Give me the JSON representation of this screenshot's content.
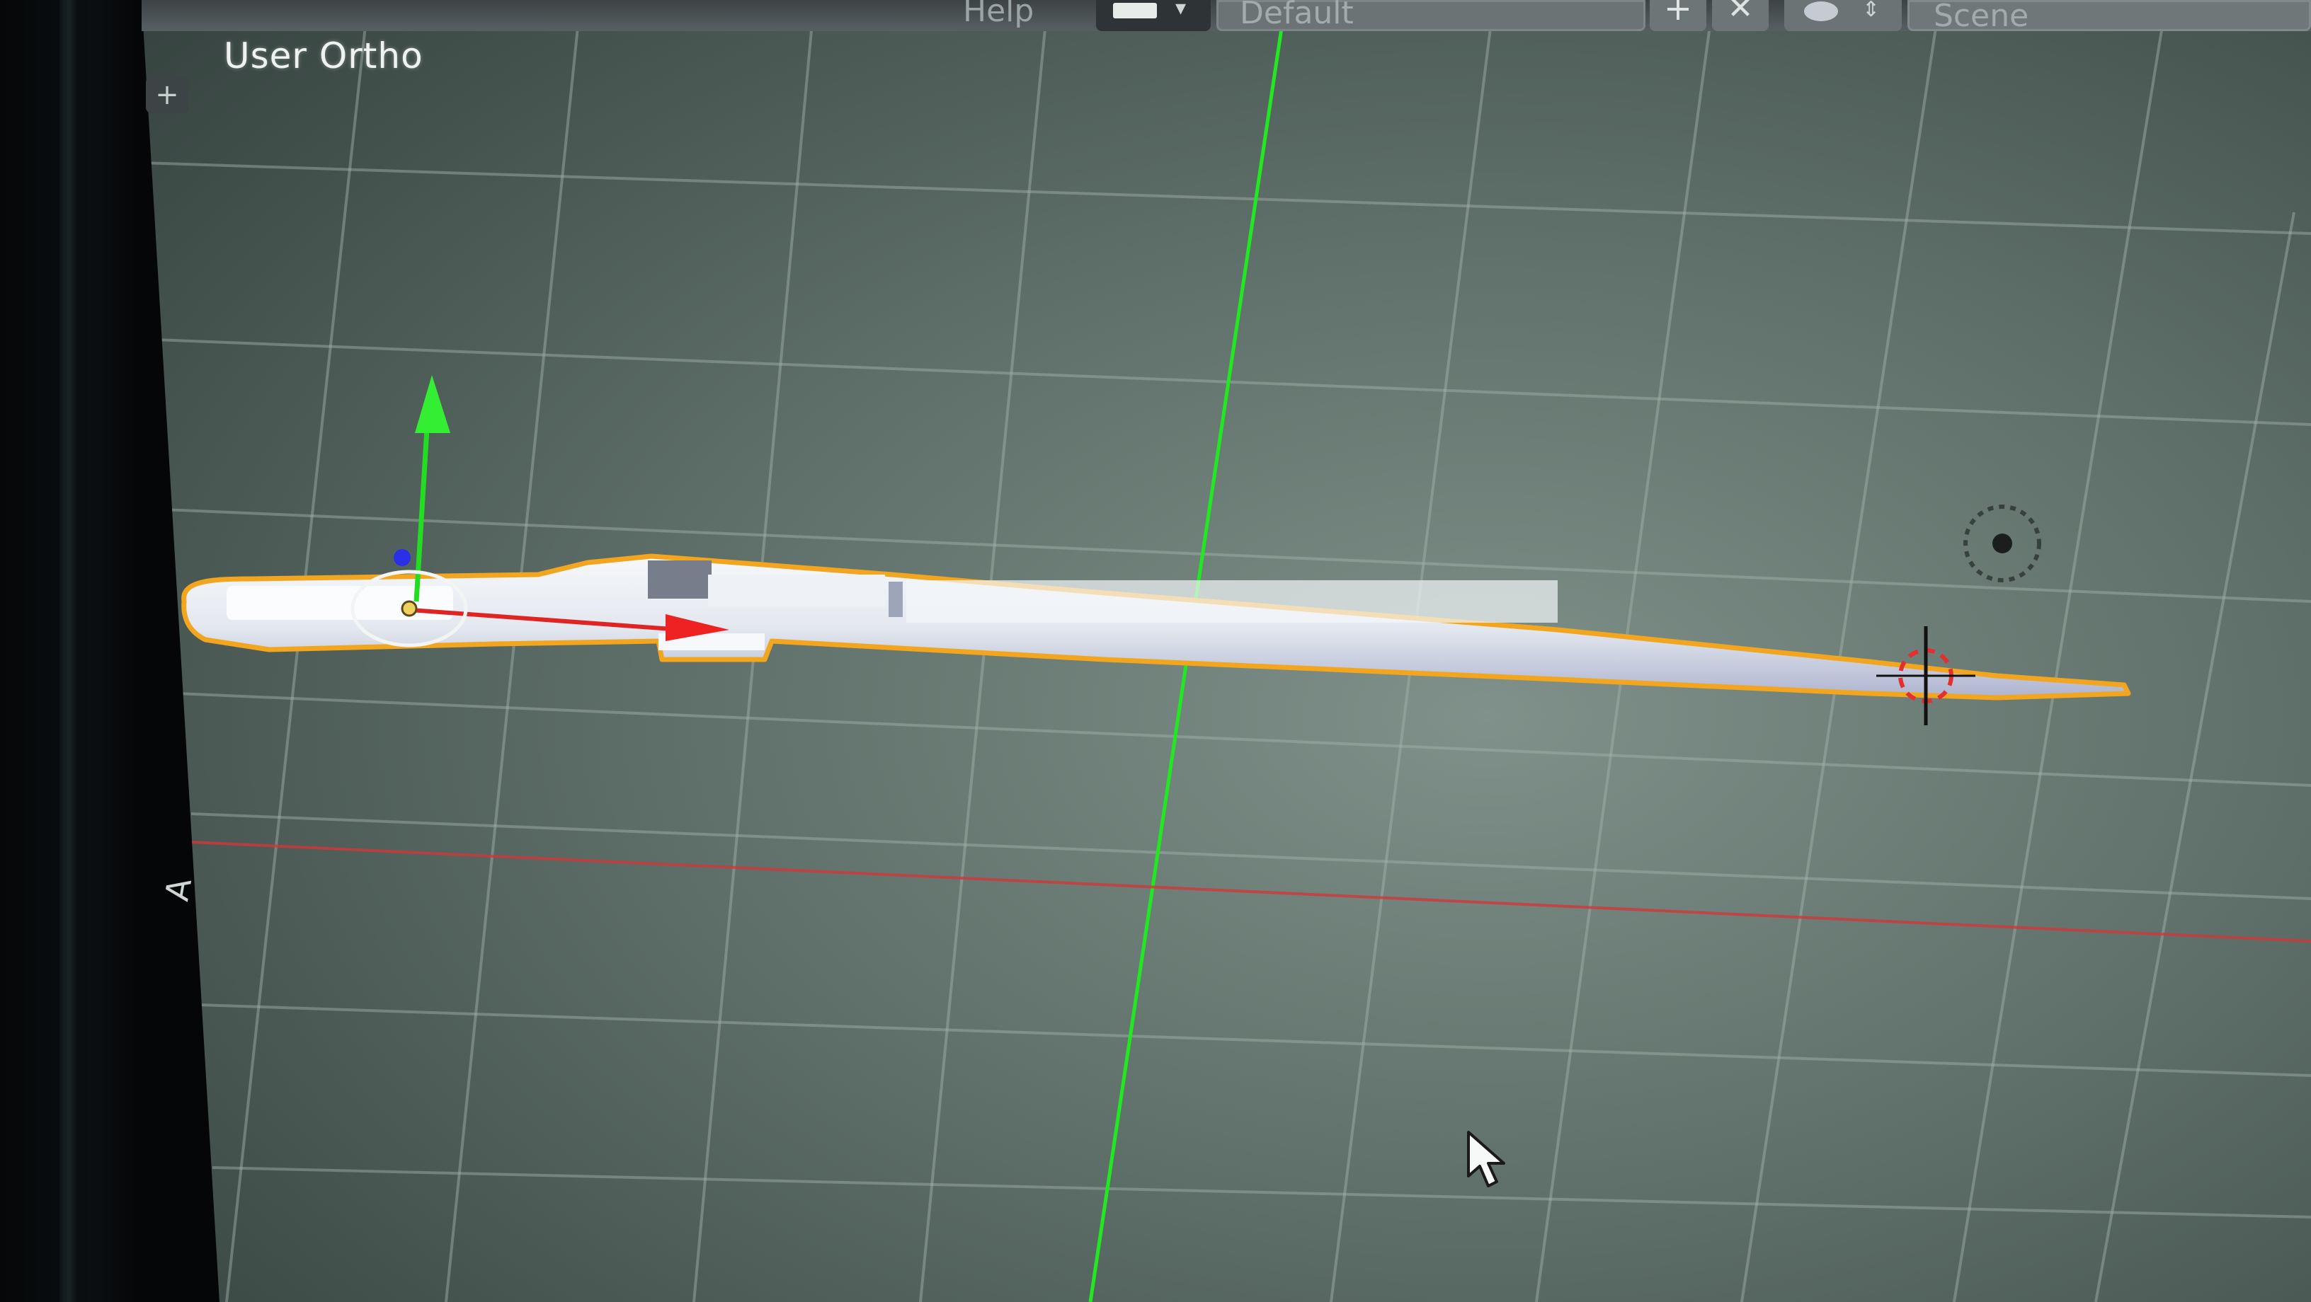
{
  "viewport": {
    "view_label": "User Ortho",
    "toolshelf_toggle": "+",
    "axis_indicator": "A"
  },
  "header": {
    "help_menu": "Help",
    "screen_layout_name": "Default",
    "scene_name": "Scene",
    "icons": {
      "layout_selector": "layout-grid-icon",
      "add_layout": "plus-icon",
      "delete_layout": "close-icon",
      "scene_selector": "scene-icon"
    }
  },
  "scene": {
    "selected_object": "sword-mesh",
    "transform_gizmo": [
      "y-axis-arrow",
      "x-axis-arrow",
      "z-axis-handle"
    ],
    "extras": [
      "3d-cursor",
      "light-lamp"
    ]
  },
  "colors": {
    "grid_line": "#9aa8a0",
    "x_axis": "#d43a3a",
    "y_axis": "#1fe01f",
    "selection_outline": "#f0a020",
    "mesh_fill": "#e6ebf2",
    "viewport_bg": "#4c5a55"
  }
}
